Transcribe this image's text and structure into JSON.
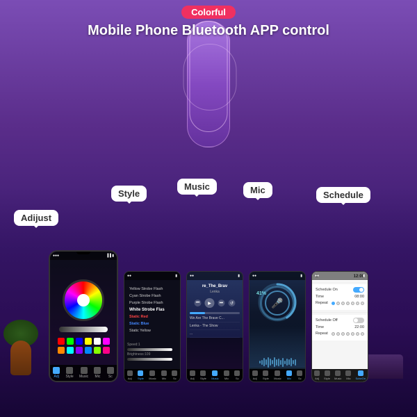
{
  "header": {
    "badge": "Colorful",
    "title_line1": "Mobile Phone Bluetooth APP control"
  },
  "bubbles": {
    "adjust": "Adijust",
    "style": "Style",
    "music": "Music",
    "mic": "Mic",
    "schedule": "Schedule"
  },
  "phone_adjust": {
    "nav_items": [
      "Adj",
      "Style",
      "Music",
      "Mic",
      "Sc"
    ]
  },
  "phone_style": {
    "items": [
      {
        "text": "Yellow Strobe Flash",
        "type": "normal"
      },
      {
        "text": "Cyan Strobe Flash",
        "type": "normal"
      },
      {
        "text": "Purple Strobe Flash",
        "type": "normal"
      },
      {
        "text": "White Strobe Flas",
        "type": "active"
      },
      {
        "text": "Static Red",
        "type": "red"
      },
      {
        "text": "Static Blue",
        "type": "blue"
      },
      {
        "text": "Static Yellow",
        "type": "normal"
      }
    ],
    "speed_label": "Speed:1",
    "brightness_label": "Brightness:109"
  },
  "phone_music": {
    "song_title": "re_The_Brav",
    "artist": "Lenka",
    "song_list": [
      "We Are The Brave C...",
      "..."
    ]
  },
  "phone_mic": {
    "percent": "41%"
  },
  "phone_schedule": {
    "schedule_on_label": "Schedule On",
    "time_label": "Time",
    "repeat_label": "Repeat",
    "schedule_off_label": "Schedule Off",
    "time_off_label": "Time",
    "repeat_off_label": "Repeat"
  },
  "colors": {
    "badge_bg": "#f03060",
    "bubble_bg": "#ffffff",
    "accent": "#44aaff",
    "nav_active": "#44aaff"
  },
  "waveform": {
    "heights": [
      4,
      7,
      12,
      8,
      15,
      10,
      6,
      14,
      9,
      11,
      7,
      13,
      5,
      10,
      8,
      12,
      6,
      9
    ]
  }
}
